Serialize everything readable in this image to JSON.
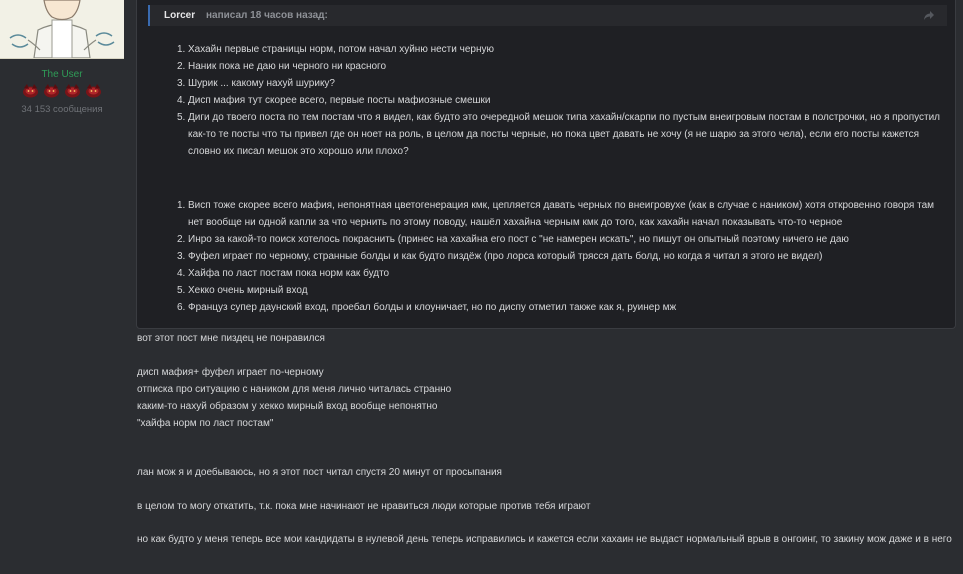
{
  "user": {
    "name": "The User",
    "message_count": "34 153 сообщения",
    "rank_icon": "red-beast-icon",
    "rank_count": 4,
    "name_color": "#2f9c57"
  },
  "quote": {
    "author": "Lorcer",
    "suffix": "написал 18 часов назад:",
    "jump_icon": "share-arrow-icon",
    "list1": [
      {
        "num": "1.",
        "text": "Хахайн первые страницы норм, потом начал хуйню нести черную"
      },
      {
        "num": "2.",
        "text": "Наник пока не даю ни черного ни красного"
      },
      {
        "num": "3.",
        "text": "Шурик ... какому нахуй шурику?"
      },
      {
        "num": "4.",
        "text": "Дисп мафия тут скорее всего, первые посты мафиозные смешки"
      },
      {
        "num": "5.",
        "text": "Диги до твоего поста по тем постам что я видел, как будто это очередной мешок типа хахайн/скарпи по пустым внеигровым постам в полстрочки, но я пропустил как-то те посты что ты привел где он ноет на роль, в целом да посты черные, но пока цвет давать не хочу (я не шарю за этого чела), если его посты кажется словно их писал мешок это хорошо или плохо?"
      }
    ],
    "list2": [
      {
        "num": "1.",
        "text": "Висп тоже скорее всего мафия, непонятная цветогенерация кмк, цепляется давать черных по внеигровухе (как в случае с наником) хотя откровенно говоря там нет вообще ни одной капли за что чернить по этому поводу, нашёл хахайна черным кмк до того, как хахайн начал показывать что-то черное"
      },
      {
        "num": "2.",
        "text": "Инро за какой-то поиск хотелось покраснить (принес на хахайна его пост с \"не намерен искать\", но пишут он опытный поэтому ничего не даю"
      },
      {
        "num": "3.",
        "text": "Фуфел играет по черному, странные болды и как будто пиздёж (про лорса который трясся дать болд, но когда я читал я этого не видел)"
      },
      {
        "num": "4.",
        "text": "Хайфа по ласт постам пока норм как будто"
      },
      {
        "num": "5.",
        "text": "Хекко очень мирный вход"
      },
      {
        "num": "6.",
        "text": "Француз супер даунский вход, проебал болды и клоуничает, но по диспу отметил также как я, руинер мж"
      }
    ]
  },
  "body": {
    "line1": "вот этот пост мне пиздец не понравился",
    "line2": "дисп мафия+ фуфел играет по-черному",
    "line3": "отписка про ситуацию с наником для меня лично читалась странно",
    "line4": "каким-то нахуй образом у хекко мирный вход вообще непонятно",
    "line5": "\"хайфа норм по ласт постам\"",
    "line6": "лан мож я и доебываюсь, но я этот пост читал спустя 20 минут от просыпания",
    "line7": "в целом то могу откатить, т.к. пока мне начинают не нравиться люди которые против тебя играют",
    "line8": "но как будто у меня теперь все мои кандидаты в нулевой день теперь исправились и кажется если хахаин не выдаст нормальный врыв в онгоинг, то закину мож даже и в него"
  }
}
